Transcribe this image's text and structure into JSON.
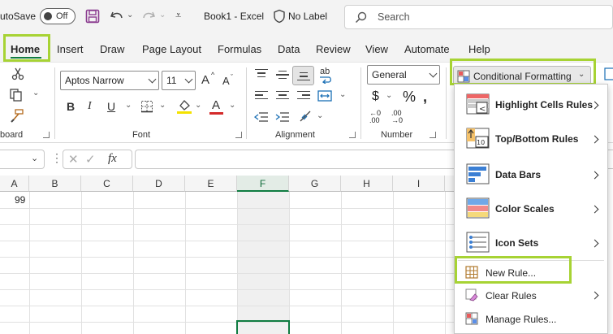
{
  "titlebar": {
    "autosave_label": "utoSave",
    "autosave_state": "Off",
    "document_title": "Book1  -  Excel",
    "label_status": "No Label",
    "search_placeholder": "Search"
  },
  "tabs": [
    "Home",
    "Insert",
    "Draw",
    "Page Layout",
    "Formulas",
    "Data",
    "Review",
    "View",
    "Automate",
    "Help"
  ],
  "active_tab": "Home",
  "ribbon": {
    "font_name": "Aptos Narrow",
    "font_size": "11",
    "number_format": "General",
    "groups": {
      "clipboard": "board",
      "font": "Font",
      "alignment": "Alignment",
      "number": "Number"
    },
    "conditional_formatting": "Conditional Formatting",
    "bold": "B",
    "italic": "I",
    "underline": "U",
    "grow_font": "A",
    "shrink_font": "A",
    "currency": "$",
    "percent": "%",
    "inc_decimal_top": "←0",
    "inc_decimal_bottom": ".00",
    "dec_decimal_top": ".00",
    "dec_decimal_bottom": "→0",
    "wrap_text": "ab"
  },
  "formula_bar": {
    "fx": "fx"
  },
  "grid": {
    "columns": [
      "A",
      "B",
      "C",
      "D",
      "E",
      "F",
      "G",
      "H",
      "I"
    ],
    "selected_column": "F",
    "cell_a1": "99"
  },
  "menu": {
    "items": [
      {
        "label": "Highlight Cells Rules",
        "submenu": true
      },
      {
        "label": "Top/Bottom Rules",
        "submenu": true
      },
      {
        "label": "Data Bars",
        "submenu": true
      },
      {
        "label": "Color Scales",
        "submenu": true
      },
      {
        "label": "Icon Sets",
        "submenu": true
      },
      {
        "label": "New Rule...",
        "submenu": false
      },
      {
        "label": "Clear Rules",
        "submenu": true
      },
      {
        "label": "Manage Rules...",
        "submenu": false
      }
    ],
    "top_bottom_icon_text": "10"
  },
  "colors": {
    "accent_green": "#107c41",
    "highlight": "#a7d334",
    "ribbon_bg": "#ffffff",
    "chrome_bg": "#f3f3f3"
  }
}
